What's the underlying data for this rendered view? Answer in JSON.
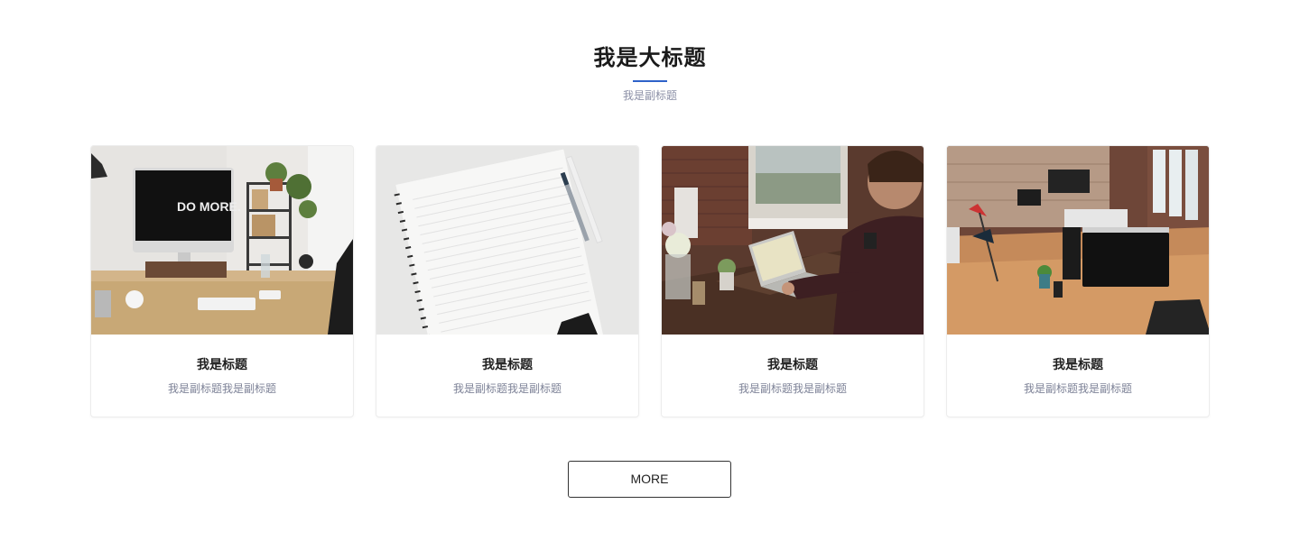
{
  "header": {
    "title": "我是大标题",
    "subtitle": "我是副标题",
    "accent_color": "#2e62c9"
  },
  "cards": [
    {
      "title": "我是标题",
      "subtitle": "我是副标题我是副标题",
      "image": "desk-imac-do-more-photo",
      "image_text": "DO MORE."
    },
    {
      "title": "我是标题",
      "subtitle": "我是副标题我是副标题",
      "image": "notebook-and-pen-photo"
    },
    {
      "title": "我是标题",
      "subtitle": "我是副标题我是副标题",
      "image": "man-typing-on-laptop-photo"
    },
    {
      "title": "我是标题",
      "subtitle": "我是副标题我是副标题",
      "image": "open-office-workspace-photo"
    }
  ],
  "more_button": {
    "label": "MORE"
  }
}
